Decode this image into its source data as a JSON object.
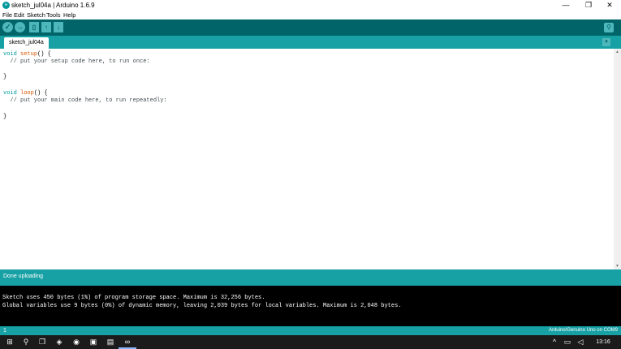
{
  "window": {
    "title": "sketch_jul04a | Arduino 1.6.9",
    "app_icon": "arduino-logo-icon",
    "controls": {
      "minimize": "—",
      "maximize": "❐",
      "close": "✕"
    }
  },
  "menu": [
    "File",
    "Edit",
    "Sketch",
    "Tools",
    "Help"
  ],
  "toolbar": {
    "verify_icon": "✓",
    "upload_icon": "→",
    "new_icon": "▯",
    "open_icon": "↑",
    "save_icon": "↓",
    "serial_monitor_icon": "⚲"
  },
  "tabs": {
    "active": "sketch_jul04a",
    "menu_icon": "▼"
  },
  "code": {
    "line1": {
      "kw": "void",
      "fn": "setup",
      "rest": "() {"
    },
    "line2": "  // put your setup code here, to run once:",
    "line3": "",
    "line4": "}",
    "line5": "",
    "line6": {
      "kw": "void",
      "fn": "loop",
      "rest": "() {"
    },
    "line7": "  // put your main code here, to run repeatedly:",
    "line8": "",
    "line9": "}"
  },
  "status": {
    "message": "Done uploading"
  },
  "console": {
    "line1": "Sketch uses 450 bytes (1%) of program storage space. Maximum is 32,256 bytes.",
    "line2": "Global variables use 9 bytes (0%) of dynamic memory, leaving 2,039 bytes for local variables. Maximum is 2,048 bytes."
  },
  "footer": {
    "line_number": "1",
    "board": "Arduino/Genuino Uno on COM9"
  },
  "taskbar": {
    "start_icon": "⊞",
    "search_icon": "⚲",
    "task_view_icon": "❐",
    "apps": [
      "◈",
      "◉",
      "▣",
      "▤",
      "∞"
    ],
    "tray_chevron": "^",
    "time": "13:16"
  },
  "colors": {
    "toolbar": "#006468",
    "accent": "#17a1a5",
    "button": "#4db7bb",
    "keyword": "#00979c",
    "function": "#d35400"
  }
}
